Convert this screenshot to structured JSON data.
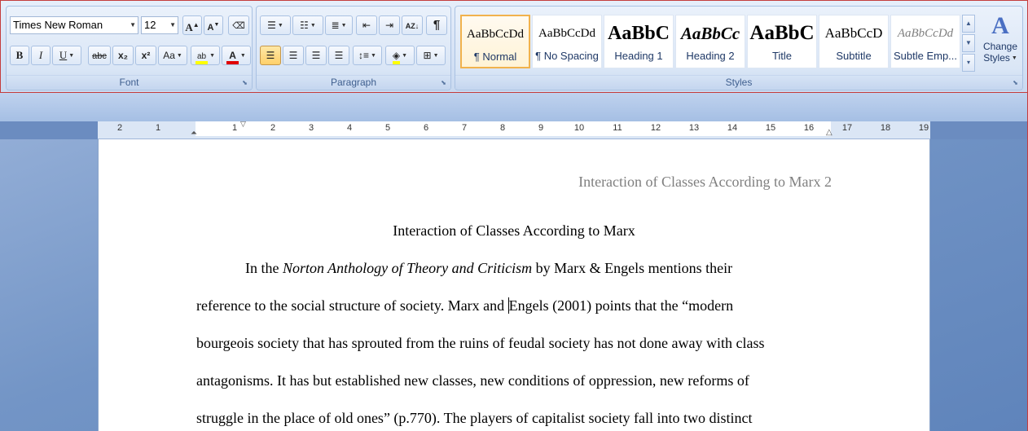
{
  "font_group": {
    "label": "Font",
    "font_name": "Times New Roman",
    "font_size": "12",
    "grow_label": "A",
    "shrink_label": "A",
    "bold": "B",
    "italic": "I",
    "underline": "U",
    "strike": "abc",
    "subscript": "x₂",
    "superscript": "x²",
    "change_case": "Aa",
    "highlight": "ab",
    "font_color": "A"
  },
  "paragraph_group": {
    "label": "Paragraph",
    "show_marks": "¶"
  },
  "styles_group": {
    "label": "Styles",
    "items": [
      {
        "sample": "AaBbCcDd",
        "name": "¶ Normal"
      },
      {
        "sample": "AaBbCcDd",
        "name": "¶ No Spacing"
      },
      {
        "sample": "AaBbC",
        "name": "Heading 1"
      },
      {
        "sample": "AaBbCc",
        "name": "Heading 2"
      },
      {
        "sample": "AaBbC",
        "name": "Title"
      },
      {
        "sample": "AaBbCcD",
        "name": "Subtitle"
      },
      {
        "sample": "AaBbCcDd",
        "name": "Subtle Emp..."
      }
    ],
    "change_styles_line1": "Change",
    "change_styles_line2": "Styles"
  },
  "ruler": {
    "left_ticks": [
      "2",
      "1"
    ],
    "right_ticks": [
      "1",
      "2",
      "3",
      "4",
      "5",
      "6",
      "7",
      "8",
      "9",
      "10",
      "11",
      "12",
      "13",
      "14",
      "15",
      "16",
      "17",
      "18",
      "19"
    ]
  },
  "document": {
    "header": "Interaction of Classes According to Marx 2",
    "title": "Interaction of Classes According to Marx",
    "lines": [
      {
        "pre": "In the ",
        "italic": "Norton Anthology of Theory and Criticism",
        "post": " by Marx & Engels mentions their"
      },
      {
        "pre": "reference to the social structure of society. Marx and ",
        "post": "Engels (2001) points that the “modern"
      },
      {
        "text": "bourgeois society that has sprouted from the ruins of feudal society has not done away with class"
      },
      {
        "text": "antagonisms. It has but established new classes, new conditions of oppression, new reforms of"
      },
      {
        "text": "struggle in the place of old ones” (p.770). The players of capitalist society fall into two distinct"
      }
    ]
  },
  "colors": {
    "accent_border": "#c43c3c",
    "ribbon_label": "#3f5f8f",
    "header_gray": "#7f7f7f"
  }
}
